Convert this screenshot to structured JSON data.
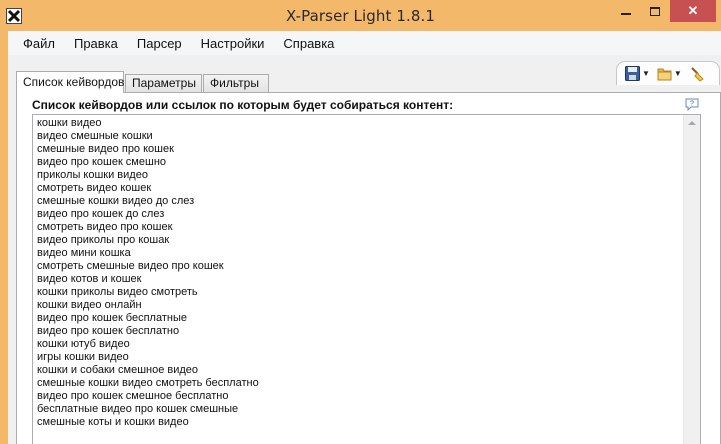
{
  "window": {
    "title": "X-Parser Light 1.8.1",
    "close_glyph": "✕"
  },
  "menu": [
    "Файл",
    "Правка",
    "Парсер",
    "Настройки",
    "Справка"
  ],
  "tabs": [
    "Список кейвордов",
    "Параметры",
    "Фильтры"
  ],
  "panel": {
    "heading": "Список кейвордов или ссылок по которым будет собираться контент:"
  },
  "keywords": [
    "кошки видео",
    "видео смешные кошки",
    "смешные видео про кошек",
    "видео про кошек смешно",
    "приколы кошки видео",
    "смотреть видео кошек",
    "смешные кошки видео до слез",
    "видео про кошек до слез",
    "смотреть видео про кошек",
    "видео приколы про кошак",
    "видео мини кошка",
    "смотреть смешные видео про кошек",
    "видео котов и кошек",
    "кошки приколы видео смотреть",
    "кошки видео онлайн",
    "видео про кошек бесплатные",
    "видео про кошек бесплатно",
    "кошки ютуб видео",
    "игры кошки видео",
    "кошки и собаки смешное видео",
    "смешные кошки видео смотреть бесплатно",
    "видео про кошек смешное бесплатно",
    "бесплатные видео про кошек смешные",
    "смешные коты и кошки видео"
  ],
  "colors": {
    "frame": "#f4b86a",
    "close_button": "#c75050"
  },
  "icons": [
    "app-x-icon",
    "minimize-icon",
    "maximize-icon",
    "close-icon",
    "save-icon",
    "folder-icon",
    "broom-icon",
    "help-icon"
  ]
}
